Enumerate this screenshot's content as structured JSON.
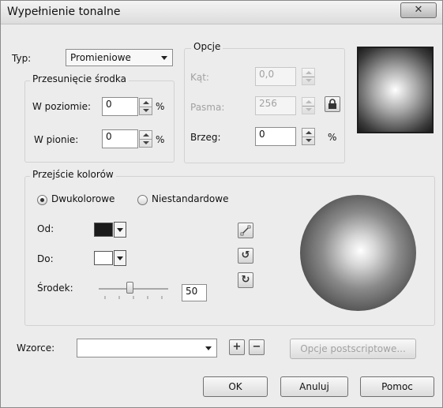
{
  "window": {
    "title": "Wypełnienie tonalne",
    "close_icon": "close-icon"
  },
  "fill_type": {
    "label": "Typ:",
    "value": "Promieniowe"
  },
  "center_offset": {
    "title": "Przesunięcie środka",
    "horizontal": {
      "label": "W poziomie:",
      "value": "0",
      "unit": "%"
    },
    "vertical": {
      "label": "W pionie:",
      "value": "0",
      "unit": "%"
    }
  },
  "options": {
    "title": "Opcje",
    "angle": {
      "label": "Kąt:",
      "value": "0,0"
    },
    "steps": {
      "label": "Pasma:",
      "value": "256",
      "lock_icon": "lock-icon"
    },
    "edge": {
      "label": "Brzeg:",
      "value": "0",
      "unit": "%"
    }
  },
  "color_blend": {
    "title": "Przejście kolorów",
    "two_color": {
      "label": "Dwukolorowe",
      "selected": true
    },
    "custom": {
      "label": "Niestandardowe",
      "selected": false
    },
    "from": {
      "label": "Od:",
      "color": "#1a1a1a"
    },
    "to": {
      "label": "Do:",
      "color": "#ffffff"
    },
    "midpoint": {
      "label": "Środek:",
      "value": "50",
      "level": 0.5
    },
    "direction_icons": [
      "line-direction-icon",
      "counterclockwise-icon",
      "clockwise-icon"
    ]
  },
  "presets": {
    "label": "Wzorce:",
    "value": "",
    "add_icon": "plus-icon",
    "remove_icon": "minus-icon"
  },
  "buttons": {
    "postscript": "Opcje postscriptowe...",
    "ok": "OK",
    "cancel": "Anuluj",
    "help": "Pomoc"
  }
}
